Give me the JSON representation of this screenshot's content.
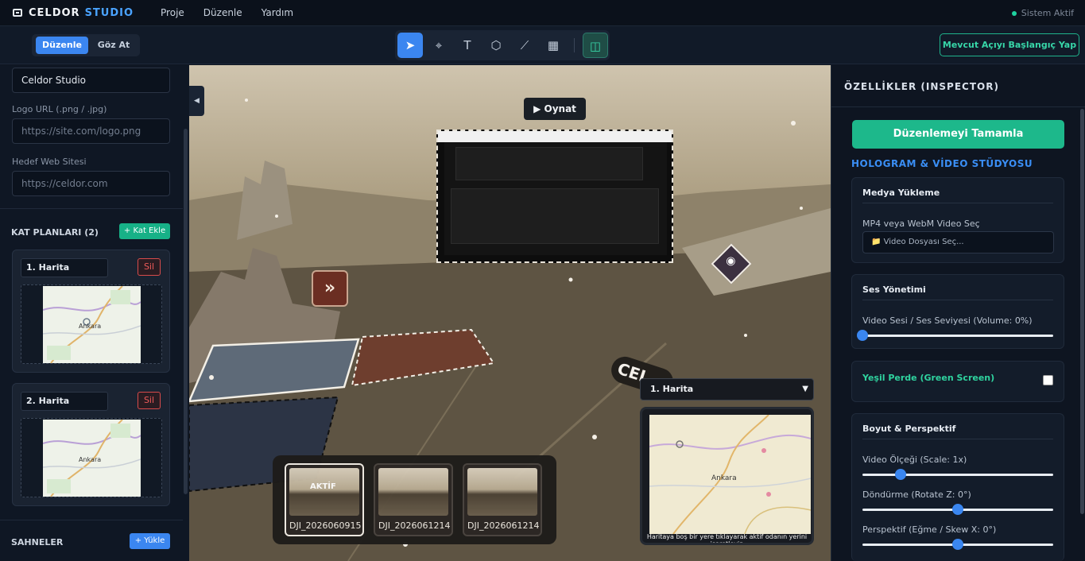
{
  "app": {
    "brand_1": "CELDOR",
    "brand_2": "STUDIO",
    "status": "Sistem Aktif"
  },
  "menu": [
    "Proje",
    "Düzenle",
    "Yardım"
  ],
  "mode_tabs": {
    "edit": "Düzenle",
    "browse": "Göz At"
  },
  "tools": [
    {
      "icon": "pointer-icon",
      "glyph": "➤",
      "active": true
    },
    {
      "icon": "pin-icon",
      "glyph": "⌖",
      "active": false
    },
    {
      "icon": "text-icon",
      "glyph": "T",
      "active": false
    },
    {
      "icon": "hexagon-icon",
      "glyph": "⬡",
      "active": false
    },
    {
      "icon": "measure-icon",
      "glyph": "⟋",
      "active": false
    },
    {
      "icon": "film-icon",
      "glyph": "▦",
      "active": false
    },
    {
      "icon": "map-icon",
      "glyph": "◫",
      "active": false
    }
  ],
  "toolbar": {
    "start_view_label": "Mevcut Açıyı Başlangıç Yap"
  },
  "left": {
    "project_name": "Celdor Studio",
    "logo_label": "Logo URL (.png / .jpg)",
    "logo_placeholder": "https://site.com/logo.png",
    "website_label": "Hedef Web Sitesi",
    "website_placeholder": "https://celdor.com",
    "floorplans_title": "KAT PLANLARI (2)",
    "add_floor_label": "+ Kat Ekle",
    "floorplans": [
      {
        "name": "1. Harita",
        "delete": "Sil",
        "map_city": "Ankara"
      },
      {
        "name": "2. Harita",
        "delete": "Sil",
        "map_city": "Ankara"
      }
    ],
    "scenes_title": "SAHNELER",
    "upload_label": "+ Yükle"
  },
  "viewport": {
    "play_label": "▶ Oynat",
    "panorama_text": "CEL",
    "scenes": [
      {
        "caption": "DJI_2026060915...",
        "tag": "AKTİF",
        "active": true
      },
      {
        "caption": "DJI_2026061214...",
        "tag": "",
        "active": false
      },
      {
        "caption": "DJI_2026061214...",
        "tag": "",
        "active": false
      }
    ],
    "minimap": {
      "selected": "1. Harita",
      "city": "Ankara",
      "caption": "Haritaya boş bir yere tıklayarak aktif odanın yerini işaretleyin"
    }
  },
  "inspector": {
    "title": "ÖZELLİKLER (INSPECTOR)",
    "done_label": "Düzenlemeyi Tamamla",
    "section_title": "HOLOGRAM & VİDEO STÜDYOSU",
    "media": {
      "title": "Medya Yükleme",
      "label": "MP4 veya WebM Video Seç",
      "file_button": "📁 Video Dosyası Seç..."
    },
    "audio": {
      "title": "Ses Yönetimi",
      "label": "Video Sesi / Ses Seviyesi (Volume: 0%)",
      "volume": 0
    },
    "green": {
      "title": "Yeşil Perde (Green Screen)",
      "checked": false
    },
    "size": {
      "title": "Boyut & Perspektif",
      "scale_label": "Video Ölçeği (Scale: 1x)",
      "scale_value": 0.2,
      "rotate_label": "Döndürme (Rotate Z: 0°)",
      "rotate_value": 0.5,
      "skew_label": "Perspektif (Eğme / Skew X: 0°)",
      "skew_value": 0.5
    }
  },
  "colors": {
    "accent_blue": "#3b86f0",
    "accent_green": "#1db88b",
    "danger": "#d84b4b"
  }
}
